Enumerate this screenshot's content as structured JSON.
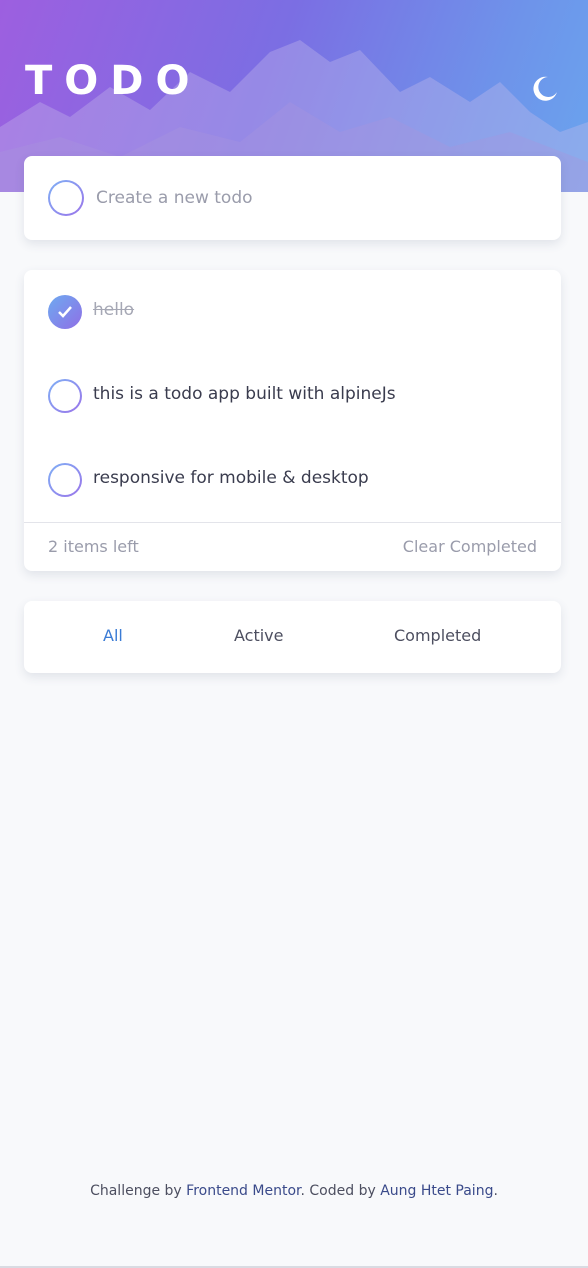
{
  "header": {
    "title": "TODO",
    "theme_icon": "moon-icon"
  },
  "new_todo": {
    "placeholder": "Create a new todo",
    "value": ""
  },
  "todos": [
    {
      "text": "hello",
      "completed": true
    },
    {
      "text": "this is a todo app built with alpineJs",
      "completed": false
    },
    {
      "text": "responsive for mobile & desktop",
      "completed": false
    }
  ],
  "list_footer": {
    "items_left": "2 items left",
    "clear_label": "Clear Completed"
  },
  "filters": {
    "all": "All",
    "active": "Active",
    "completed": "Completed",
    "selected": "All"
  },
  "attribution": {
    "prefix": "Challenge by ",
    "link1": "Frontend Mentor",
    "middle": ". Coded by ",
    "link2": "Aung Htet Paing",
    "suffix": "."
  },
  "colors": {
    "accent": "#3a7bd5",
    "gradient_start": "#9d5fe0",
    "gradient_end": "#6aa4ee",
    "background": "#f8f9fb"
  }
}
